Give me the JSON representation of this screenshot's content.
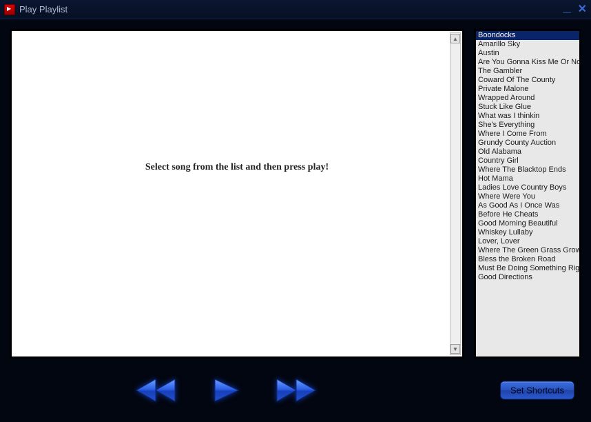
{
  "window": {
    "title": "Play Playlist"
  },
  "video": {
    "prompt": "Select song from the list and then press play!"
  },
  "playlist": {
    "selected_index": 0,
    "items": [
      "Boondocks",
      "Amarillo Sky",
      "Austin",
      "Are You Gonna Kiss Me Or Not",
      "The Gambler",
      "Coward Of The County",
      "Private Malone",
      "Wrapped Around",
      "Stuck Like Glue",
      "What was I thinkin",
      "She's Everything",
      "Where I Come From",
      "Grundy County Auction",
      "Old Alabama",
      "Country Girl",
      "Where The Blacktop Ends",
      "Hot Mama",
      "Ladies Love Country Boys",
      "Where Were You",
      "As Good As I Once Was",
      "Before He Cheats",
      "Good Morning Beautiful",
      "Whiskey Lullaby",
      "Lover, Lover",
      "Where The Green Grass Grows",
      "Bless the Broken Road",
      "Must Be Doing Something Right",
      "Good Directions"
    ]
  },
  "controls": {
    "set_shortcuts_label": "Set Shortcuts"
  },
  "colors": {
    "accent_blue": "#2e60e8",
    "window_bg": "#020610"
  }
}
